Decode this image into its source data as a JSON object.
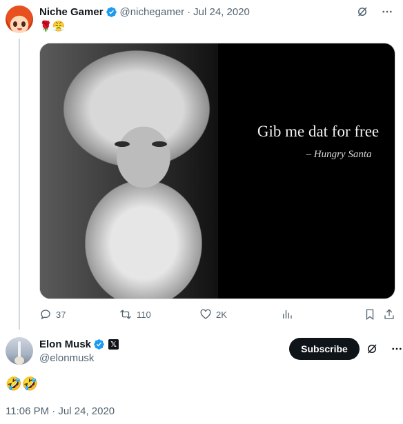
{
  "parent_tweet": {
    "display_name": "Niche Gamer",
    "handle": "@nichegamer",
    "separator": "·",
    "date": "Jul 24, 2020",
    "text": "🌹😤",
    "media": {
      "quote_main": "Gib me dat for free",
      "quote_attribution": "– Hungry Santa"
    },
    "stats": {
      "replies": "37",
      "retweets": "110",
      "likes": "2K"
    }
  },
  "reply_tweet": {
    "display_name": "Elon Musk",
    "handle": "@elonmusk",
    "affiliate_badge": "𝕏",
    "subscribe_label": "Subscribe",
    "text": "🤣🤣",
    "timestamp": "11:06 PM · Jul 24, 2020"
  },
  "colors": {
    "verified_blue": "#1d9bf0",
    "muted_text": "#536471",
    "primary_text": "#0f1419",
    "subscribe_bg": "#0f1419"
  },
  "icons": [
    "grok-icon",
    "more-icon",
    "reply-icon",
    "retweet-icon",
    "like-icon",
    "views-icon",
    "bookmark-icon",
    "share-icon",
    "verified-icon"
  ]
}
